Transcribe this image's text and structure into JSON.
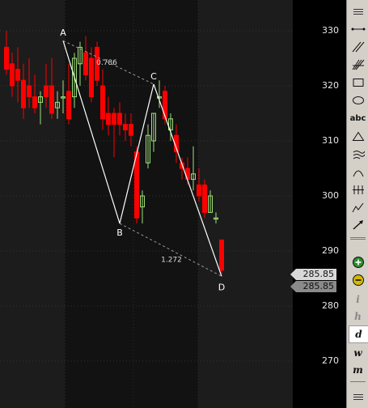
{
  "chart_data": {
    "type": "candlestick",
    "y_ticks": [
      "330",
      "320",
      "310",
      "300",
      "290",
      "280",
      "270"
    ],
    "y_tick_values": [
      330,
      320,
      310,
      300,
      290,
      280,
      270
    ],
    "candles": [
      {
        "o": 327,
        "h": 330,
        "l": 322,
        "c": 323
      },
      {
        "o": 324,
        "h": 326,
        "l": 318,
        "c": 320
      },
      {
        "o": 323,
        "h": 327,
        "l": 317,
        "c": 321
      },
      {
        "o": 321,
        "h": 324,
        "l": 314,
        "c": 316
      },
      {
        "o": 320,
        "h": 325,
        "l": 316,
        "c": 318
      },
      {
        "o": 318,
        "h": 322,
        "l": 315,
        "c": 316
      },
      {
        "o": 317,
        "h": 319,
        "l": 313,
        "c": 318
      },
      {
        "o": 320,
        "h": 324,
        "l": 316,
        "c": 318
      },
      {
        "o": 320,
        "h": 325,
        "l": 314,
        "c": 315
      },
      {
        "o": 316,
        "h": 319,
        "l": 314,
        "c": 317
      },
      {
        "o": 318,
        "h": 321,
        "l": 315,
        "c": 318
      },
      {
        "o": 319,
        "h": 324,
        "l": 313,
        "c": 314
      },
      {
        "o": 318,
        "h": 326,
        "l": 316,
        "c": 325
      },
      {
        "o": 324,
        "h": 328,
        "l": 320,
        "c": 327
      },
      {
        "o": 326,
        "h": 329,
        "l": 321,
        "c": 322
      },
      {
        "o": 325,
        "h": 327,
        "l": 317,
        "c": 318
      },
      {
        "o": 327,
        "h": 328,
        "l": 320,
        "c": 321
      },
      {
        "o": 320,
        "h": 323,
        "l": 312,
        "c": 314
      },
      {
        "o": 315,
        "h": 318,
        "l": 311,
        "c": 313
      },
      {
        "o": 315,
        "h": 316,
        "l": 307,
        "c": 313
      },
      {
        "o": 315,
        "h": 317,
        "l": 311,
        "c": 313
      },
      {
        "o": 313,
        "h": 315,
        "l": 310,
        "c": 312
      },
      {
        "o": 313,
        "h": 315,
        "l": 309,
        "c": 311
      },
      {
        "o": 308,
        "h": 309,
        "l": 295,
        "c": 296
      },
      {
        "o": 298,
        "h": 301,
        "l": 295,
        "c": 300
      },
      {
        "o": 306,
        "h": 313,
        "l": 305,
        "c": 311
      },
      {
        "o": 310,
        "h": 315,
        "l": 308,
        "c": 315
      },
      {
        "o": 318,
        "h": 321,
        "l": 316,
        "c": 318
      },
      {
        "o": 319,
        "h": 320,
        "l": 313,
        "c": 314
      },
      {
        "o": 312,
        "h": 315,
        "l": 310,
        "c": 314
      },
      {
        "o": 311,
        "h": 313,
        "l": 306,
        "c": 308
      },
      {
        "o": 306,
        "h": 307,
        "l": 303,
        "c": 305
      },
      {
        "o": 305,
        "h": 307,
        "l": 302,
        "c": 303
      },
      {
        "o": 303,
        "h": 309,
        "l": 301,
        "c": 304
      },
      {
        "o": 302,
        "h": 305,
        "l": 299,
        "c": 300
      },
      {
        "o": 302,
        "h": 303,
        "l": 296,
        "c": 297
      },
      {
        "o": 297,
        "h": 301,
        "l": 297,
        "c": 300
      },
      {
        "o": 296,
        "h": 297,
        "l": 295,
        "c": 296
      },
      {
        "o": 292,
        "h": 292,
        "l": 285.85,
        "c": 286.5
      }
    ],
    "colors": {
      "up": "#9ee07a",
      "down": "#ff0000",
      "pattern_line": "#ffffff",
      "ratio_line": "#9a9a9a"
    },
    "pattern_points": [
      {
        "label": "A",
        "price": 328.2
      },
      {
        "label": "B",
        "price": 295
      },
      {
        "label": "C",
        "price": 320.3
      },
      {
        "label": "D",
        "price": 285.4
      }
    ],
    "ratios": [
      "0.786",
      "1.272"
    ],
    "price_tags": [
      "285.85",
      "285.85"
    ]
  },
  "toolbar": {
    "items": [
      "menu-icon",
      "horizontal-line-icon",
      "parallel-lines-icon",
      "fan-lines-icon",
      "rectangle-icon",
      "ellipse-icon",
      "text-tool",
      "triangle-icon",
      "wave-icon",
      "arc-icon",
      "ruler-icon",
      "zigzag-icon",
      "arrow-icon",
      "zoom-in-icon",
      "zoom-out-icon",
      "interval-i",
      "interval-h",
      "interval-d",
      "interval-w",
      "interval-m",
      "menu-icon-bottom"
    ],
    "text_label": "abc",
    "interval_i": "i",
    "interval_h": "h",
    "interval_d": "d",
    "interval_w": "w",
    "interval_m": "m"
  }
}
